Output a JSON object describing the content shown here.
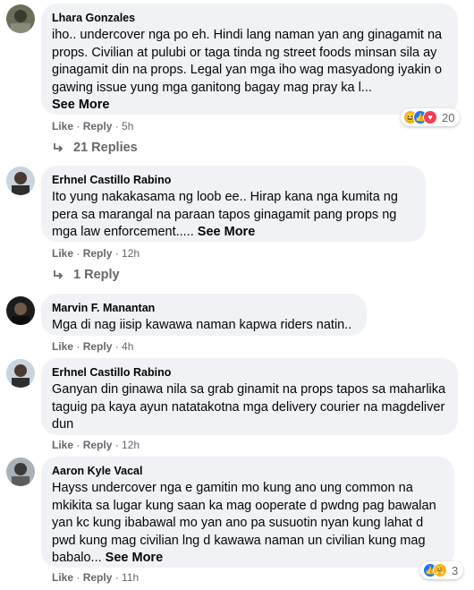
{
  "comments": [
    {
      "author": "Lhara Gonzales",
      "text": "iho.. undercover nga po eh. Hindi lang naman yan ang ginagamit na props. Civilian at pulubi or taga tinda ng street foods minsan sila ay ginagamit din na props. Legal yan mga iho wag masyadong iyakin o gawing issue yung mga ganitong bagay mag pray ka l...",
      "see_more": "See More",
      "like": "Like",
      "reply": "Reply",
      "time": "5h",
      "reactions_count": "20",
      "replies": "21 Replies"
    },
    {
      "author": "Erhnel Castillo Rabino",
      "text": "Ito yung nakakasama ng loob ee.. Hirap kana nga kumita ng pera sa marangal na paraan tapos ginagamit pang props ng mga law enforcement.....",
      "see_more": "See More",
      "like": "Like",
      "reply": "Reply",
      "time": "12h",
      "replies": "1 Reply"
    },
    {
      "author": "Marvin F. Manantan",
      "text": "Mga di nag iisip kawawa naman kapwa riders natin..",
      "like": "Like",
      "reply": "Reply",
      "time": "4h"
    },
    {
      "author": "Erhnel Castillo Rabino",
      "text": "Ganyan din ginawa nila sa grab ginamit na props tapos sa maharlika taguig pa kaya ayun natatakotna mga delivery courier na magdeliver dun",
      "like": "Like",
      "reply": "Reply",
      "time": "12h"
    },
    {
      "author": "Aaron Kyle Vacal",
      "text": "Hayss undercover nga e gamitin mo kung ano ung common na mkikita sa lugar kung saan ka mag ooperate d pwdng pag bawalan yan kc kung ibabawal mo yan ano pa susuotin nyan kung lahat d pwd kung mag civilian lng d kawawa naman un civilian kung mag babalo...",
      "see_more": "See More",
      "like": "Like",
      "reply": "Reply",
      "time": "11h",
      "reactions_count": "3"
    }
  ],
  "colors": {
    "bubble": "#f0f2f5",
    "meta": "#65676b",
    "like_blue": "#1877f2"
  }
}
